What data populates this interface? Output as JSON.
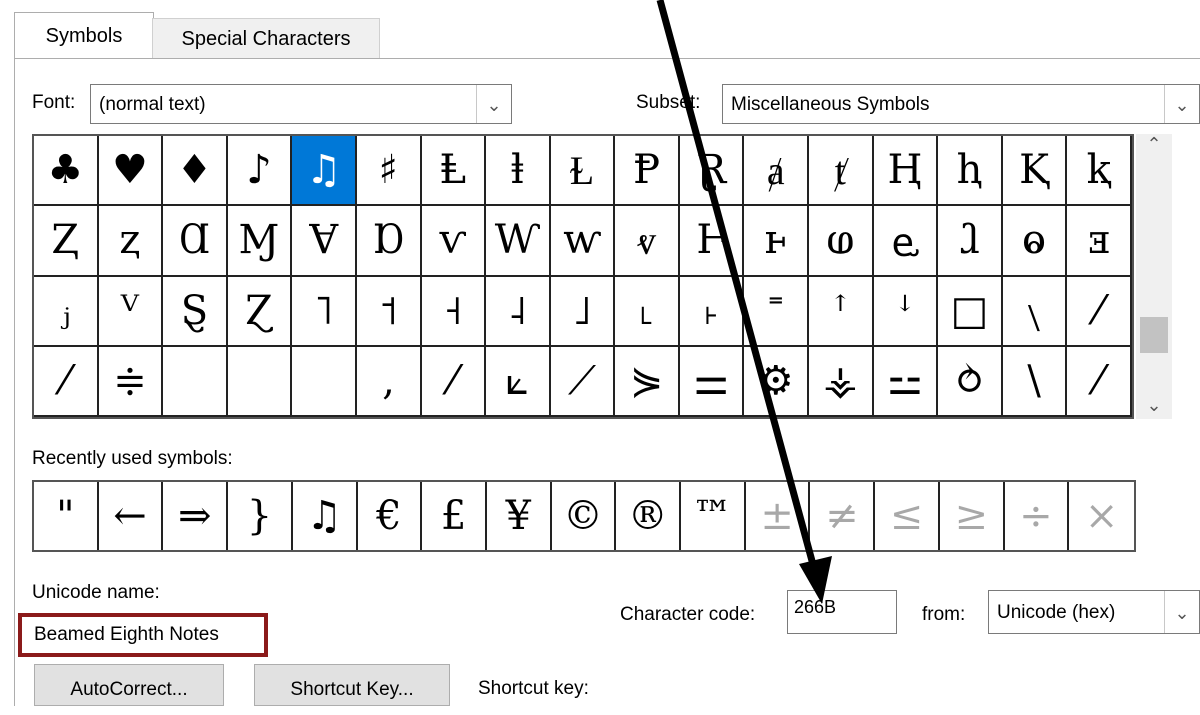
{
  "tabs": {
    "symbols": "Symbols",
    "special": "Special Characters"
  },
  "font": {
    "label": "Font:",
    "value": "(normal text)"
  },
  "subset": {
    "label": "Subset:",
    "value": "Miscellaneous Symbols"
  },
  "grid": {
    "rows": [
      [
        "♣",
        "♥",
        "♦",
        "♪",
        "♫",
        "♯",
        "Ⱡ",
        "ⱡ",
        "Ɫ",
        "Ᵽ",
        "Ɽ",
        "ⱥ",
        "ⱦ",
        "Ⱨ",
        "ⱨ",
        "Ⱪ",
        "ⱪ"
      ],
      [
        "Ⱬ",
        "ⱬ",
        "Ɑ",
        "Ɱ",
        "Ɐ",
        "Ɒ",
        "ⱱ",
        "Ⱳ",
        "ⱳ",
        "ⱴ",
        "Ⱶ",
        "ⱶ",
        "ⱷ",
        "ⱸ",
        "ⱹ",
        "ⱺ",
        "ⱻ"
      ],
      [
        "ⱼ",
        "ⱽ",
        "Ȿ",
        "Ɀ",
        "˥",
        "˦",
        "˧",
        "˨",
        "˩",
        "˪",
        "˫",
        "˭",
        "ꜛ",
        "ꜜ",
        "□",
        "﹨",
        "⁄"
      ],
      [
        "⁄",
        "≑",
        "",
        "",
        "",
        "‚",
        "⁄",
        "⟀",
        "⟋",
        "⋟",
        "⚌",
        "⚙",
        "⚶",
        "⚍",
        "⥁",
        "\\",
        "⁄"
      ]
    ],
    "selected": 4
  },
  "recent": {
    "label": "Recently used symbols:",
    "items": [
      "\"",
      "←",
      "⇒",
      "}",
      "♫",
      "€",
      "£",
      "¥",
      "©",
      "®",
      "™",
      "±",
      "≠",
      "≤",
      "≥",
      "÷",
      "×"
    ]
  },
  "unicode_name": {
    "label": "Unicode name:",
    "value": "Beamed Eighth Notes"
  },
  "char_code": {
    "label": "Character code:",
    "value": "266B"
  },
  "from": {
    "label": "from:",
    "value": "Unicode (hex)"
  },
  "buttons": {
    "autocorrect": "AutoCorrect...",
    "shortcut": "Shortcut Key...",
    "shortcut_label": "Shortcut key:"
  },
  "icons": {
    "dropdown": "chevron-down-icon",
    "scroll_up": "chevron-up-icon",
    "scroll_down": "chevron-down-icon",
    "annotation": "arrow-icon"
  },
  "colors": {
    "selection": "#0078d7",
    "annotation_box": "#8b1a1a"
  }
}
